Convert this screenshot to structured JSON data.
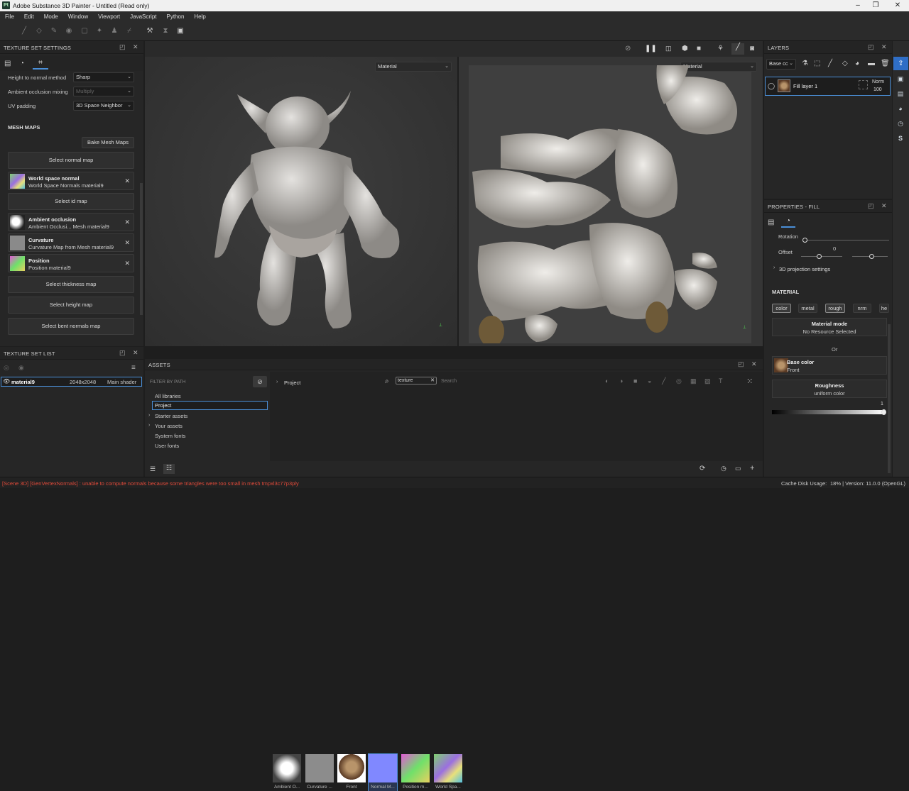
{
  "window": {
    "title": "Adobe Substance 3D Painter - Untitled (Read only)",
    "logo": "Pt"
  },
  "menu": [
    "File",
    "Edit",
    "Mode",
    "Window",
    "Viewport",
    "JavaScript",
    "Python",
    "Help"
  ],
  "texture_set_settings": {
    "title": "TEXTURE SET SETTINGS",
    "height_to_normal_label": "Height to normal method",
    "height_to_normal_value": "Sharp",
    "ao_mixing_label": "Ambient occlusion mixing",
    "ao_mixing_value": "Multiply",
    "uv_padding_label": "UV padding",
    "uv_padding_value": "3D Space Neighbor",
    "mesh_maps_title": "MESH MAPS",
    "bake_button": "Bake Mesh Maps",
    "select_normal": "Select normal map",
    "world_normal_name": "World space normal",
    "world_normal_sub": "World Space Normals material9",
    "select_id": "Select id map",
    "ao_name": "Ambient occlusion",
    "ao_sub": "Ambient Occlusi... Mesh material9",
    "curv_name": "Curvature",
    "curv_sub": "Curvature Map from Mesh material9",
    "pos_name": "Position",
    "pos_sub": "Position material9",
    "select_thickness": "Select thickness map",
    "select_height": "Select height map",
    "select_bent": "Select bent normals map"
  },
  "texture_set_list": {
    "title": "TEXTURE SET LIST",
    "item_name": "material9",
    "item_res": "2048x2048",
    "item_shader": "Main shader"
  },
  "viewport": {
    "left_mode": "Material",
    "right_mode": "Material"
  },
  "assets": {
    "title": "ASSETS",
    "filter_label": "FILTER BY PATH",
    "tree": [
      "All libraries",
      "Project",
      "Starter assets",
      "Your assets",
      "System fonts",
      "User fonts"
    ],
    "breadcrumb": "Project",
    "search_tag": "texture",
    "search_placeholder": "Search",
    "items": [
      "Ambient O...",
      "Curvature ...",
      "Front",
      "Normal M...",
      "Position m...",
      "World Spa..."
    ]
  },
  "layers": {
    "title": "LAYERS",
    "channel": "Base cc",
    "layer_name": "Fill layer 1",
    "blend": "Norm",
    "opacity": "100"
  },
  "properties": {
    "title": "PROPERTIES - FILL",
    "rotation_label": "Rotation",
    "offset_label": "Offset",
    "offset_value": "0",
    "projection": "3D projection settings",
    "material_title": "MATERIAL",
    "channels": [
      "color",
      "metal",
      "rough",
      "nrm",
      "he"
    ],
    "material_mode_label": "Material mode",
    "material_mode_value": "No Resource Selected",
    "or_label": "Or",
    "base_color_label": "Base color",
    "base_color_value": "Front",
    "roughness_label": "Roughness",
    "roughness_value": "uniform color",
    "slider_value": "1"
  },
  "status": {
    "error": "[Scene 3D] [GenVertexNormals] : unable to compute normals because some triangles were too small in mesh tmpxl3c77p3ply",
    "cache": "Cache Disk Usage:",
    "version": "18% | Version: 11.0.0 (OpenGL)"
  },
  "colors": {
    "accent": "#4a8fd8",
    "error": "#e04a3a"
  }
}
